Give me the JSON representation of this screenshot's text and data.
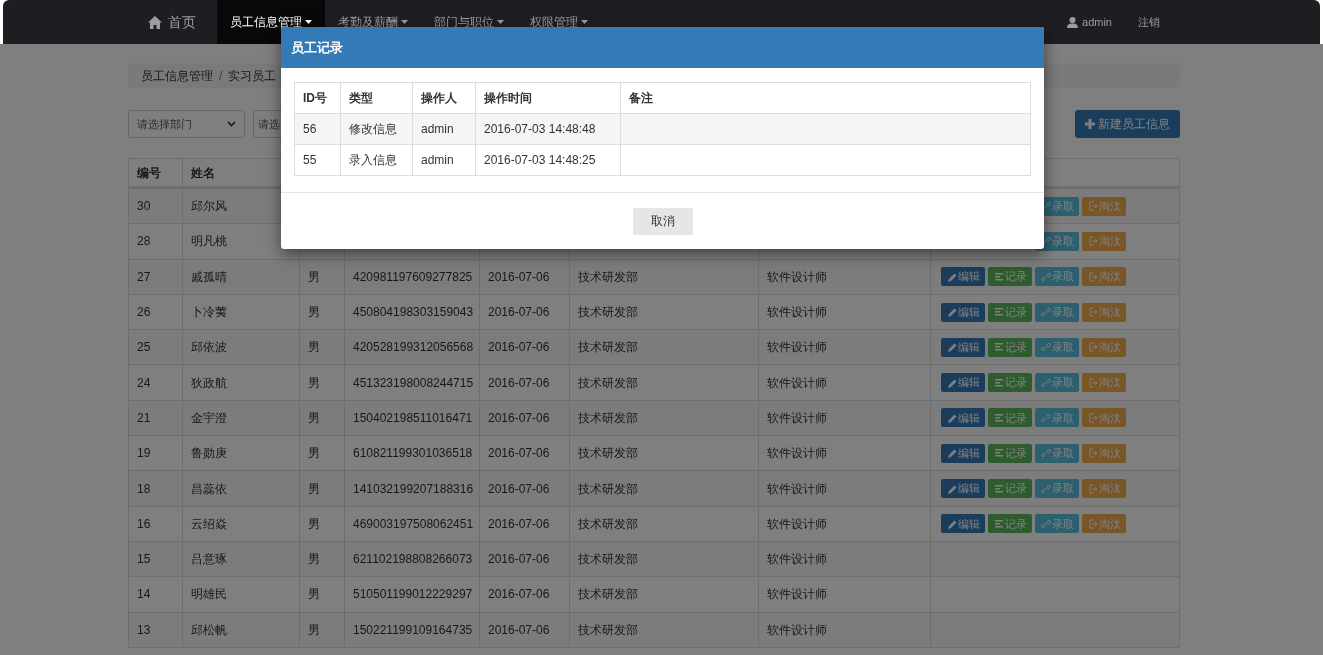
{
  "navbar": {
    "items": [
      {
        "label": "首页",
        "kind": "home",
        "selected": false,
        "dropdown": false
      },
      {
        "label": "员工信息管理",
        "kind": "menu",
        "selected": true,
        "dropdown": true
      },
      {
        "label": "考勤及薪酬",
        "kind": "menu",
        "selected": false,
        "dropdown": true
      },
      {
        "label": "部门与职位",
        "kind": "menu",
        "selected": false,
        "dropdown": true
      },
      {
        "label": "权限管理",
        "kind": "menu",
        "selected": false,
        "dropdown": true
      }
    ],
    "user": "admin",
    "logout": "注销"
  },
  "breadcrumb": {
    "items": [
      "员工信息管理",
      "实习员工"
    ],
    "separator": "/"
  },
  "filters": [
    {
      "value": "请选择部门"
    },
    {
      "value": "请选"
    }
  ],
  "new_button": "新建员工信息",
  "table": {
    "columns": [
      "编号",
      "姓名"
    ],
    "rows": [
      {
        "id": "30",
        "name": "邱尔风",
        "actions": [
          {
            "kind": "recruit",
            "label": "录取"
          },
          {
            "kind": "dismiss",
            "label": "淘汰"
          }
        ]
      },
      {
        "id": "28",
        "name": "明凡桃",
        "actions": [
          {
            "kind": "recruit",
            "label": "录取"
          },
          {
            "kind": "dismiss",
            "label": "淘汰"
          }
        ]
      },
      {
        "id": "27",
        "name": "戚孤晴",
        "gender": "男",
        "id_number": "420981197609277825",
        "date": "2016-07-06",
        "department": "技术研发部",
        "position": "软件设计师",
        "actions": [
          {
            "kind": "edit",
            "label": "编辑"
          },
          {
            "kind": "record",
            "label": "记录"
          },
          {
            "kind": "recruit",
            "label": "录取"
          },
          {
            "kind": "dismiss",
            "label": "淘汰"
          }
        ]
      },
      {
        "id": "26",
        "name": "卜冷荑",
        "gender": "男",
        "id_number": "450804198303159043",
        "date": "2016-07-06",
        "department": "技术研发部",
        "position": "软件设计师",
        "actions": [
          {
            "kind": "edit",
            "label": "编辑"
          },
          {
            "kind": "record",
            "label": "记录"
          },
          {
            "kind": "recruit",
            "label": "录取"
          },
          {
            "kind": "dismiss",
            "label": "淘汰"
          }
        ]
      },
      {
        "id": "25",
        "name": "邱依波",
        "gender": "男",
        "id_number": "420528199312056568",
        "date": "2016-07-06",
        "department": "技术研发部",
        "position": "软件设计师",
        "actions": [
          {
            "kind": "edit",
            "label": "编辑"
          },
          {
            "kind": "record",
            "label": "记录"
          },
          {
            "kind": "recruit",
            "label": "录取"
          },
          {
            "kind": "dismiss",
            "label": "淘汰"
          }
        ]
      },
      {
        "id": "24",
        "name": "狄政航",
        "gender": "男",
        "id_number": "451323198008244715",
        "date": "2016-07-06",
        "department": "技术研发部",
        "position": "软件设计师",
        "actions": [
          {
            "kind": "edit",
            "label": "编辑"
          },
          {
            "kind": "record",
            "label": "记录"
          },
          {
            "kind": "recruit",
            "label": "录取"
          },
          {
            "kind": "dismiss",
            "label": "淘汰"
          }
        ]
      },
      {
        "id": "21",
        "name": "金宇澄",
        "gender": "男",
        "id_number": "150402198511016471",
        "date": "2016-07-06",
        "department": "技术研发部",
        "position": "软件设计师",
        "actions": [
          {
            "kind": "edit",
            "label": "编辑"
          },
          {
            "kind": "record",
            "label": "记录"
          },
          {
            "kind": "recruit",
            "label": "录取"
          },
          {
            "kind": "dismiss",
            "label": "淘汰"
          }
        ]
      },
      {
        "id": "19",
        "name": "鲁勋庚",
        "gender": "男",
        "id_number": "610821199301036518",
        "date": "2016-07-06",
        "department": "技术研发部",
        "position": "软件设计师",
        "actions": [
          {
            "kind": "edit",
            "label": "编辑"
          },
          {
            "kind": "record",
            "label": "记录"
          },
          {
            "kind": "recruit",
            "label": "录取"
          },
          {
            "kind": "dismiss",
            "label": "淘汰"
          }
        ]
      },
      {
        "id": "18",
        "name": "昌蕊依",
        "gender": "男",
        "id_number": "141032199207188316",
        "date": "2016-07-06",
        "department": "技术研发部",
        "position": "软件设计师",
        "actions": [
          {
            "kind": "edit",
            "label": "编辑"
          },
          {
            "kind": "record",
            "label": "记录"
          },
          {
            "kind": "recruit",
            "label": "录取"
          },
          {
            "kind": "dismiss",
            "label": "淘汰"
          }
        ]
      },
      {
        "id": "16",
        "name": "云绍焱",
        "gender": "男",
        "id_number": "469003197508062451",
        "date": "2016-07-06",
        "department": "技术研发部",
        "position": "软件设计师",
        "actions": [
          {
            "kind": "edit",
            "label": "编辑"
          },
          {
            "kind": "record",
            "label": "记录"
          },
          {
            "kind": "recruit",
            "label": "录取"
          },
          {
            "kind": "dismiss",
            "label": "淘汰"
          }
        ]
      },
      {
        "id": "15",
        "name": "吕意琢",
        "gender": "男",
        "id_number": "621102198808266073",
        "date": "2016-07-06",
        "department": "技术研发部",
        "position": "软件设计师"
      },
      {
        "id": "14",
        "name": "明雄民",
        "gender": "男",
        "id_number": "510501199012229297",
        "date": "2016-07-06",
        "department": "技术研发部",
        "position": "软件设计师"
      },
      {
        "id": "13",
        "name": "邱松帆",
        "gender": "男",
        "id_number": "150221199109164735",
        "date": "2016-07-06",
        "department": "技术研发部",
        "position": "软件设计师"
      }
    ]
  },
  "modal": {
    "title": "员工记录",
    "columns": [
      "ID号",
      "类型",
      "操作人",
      "操作时间",
      "备注"
    ],
    "rows": [
      {
        "id": "56",
        "type": "修改信息",
        "operator": "admin",
        "time": "2016-07-03 14:48:48"
      },
      {
        "id": "55",
        "type": "录入信息",
        "operator": "admin",
        "time": "2016-07-03 14:48:25"
      }
    ],
    "buttons": [
      "取消"
    ]
  }
}
